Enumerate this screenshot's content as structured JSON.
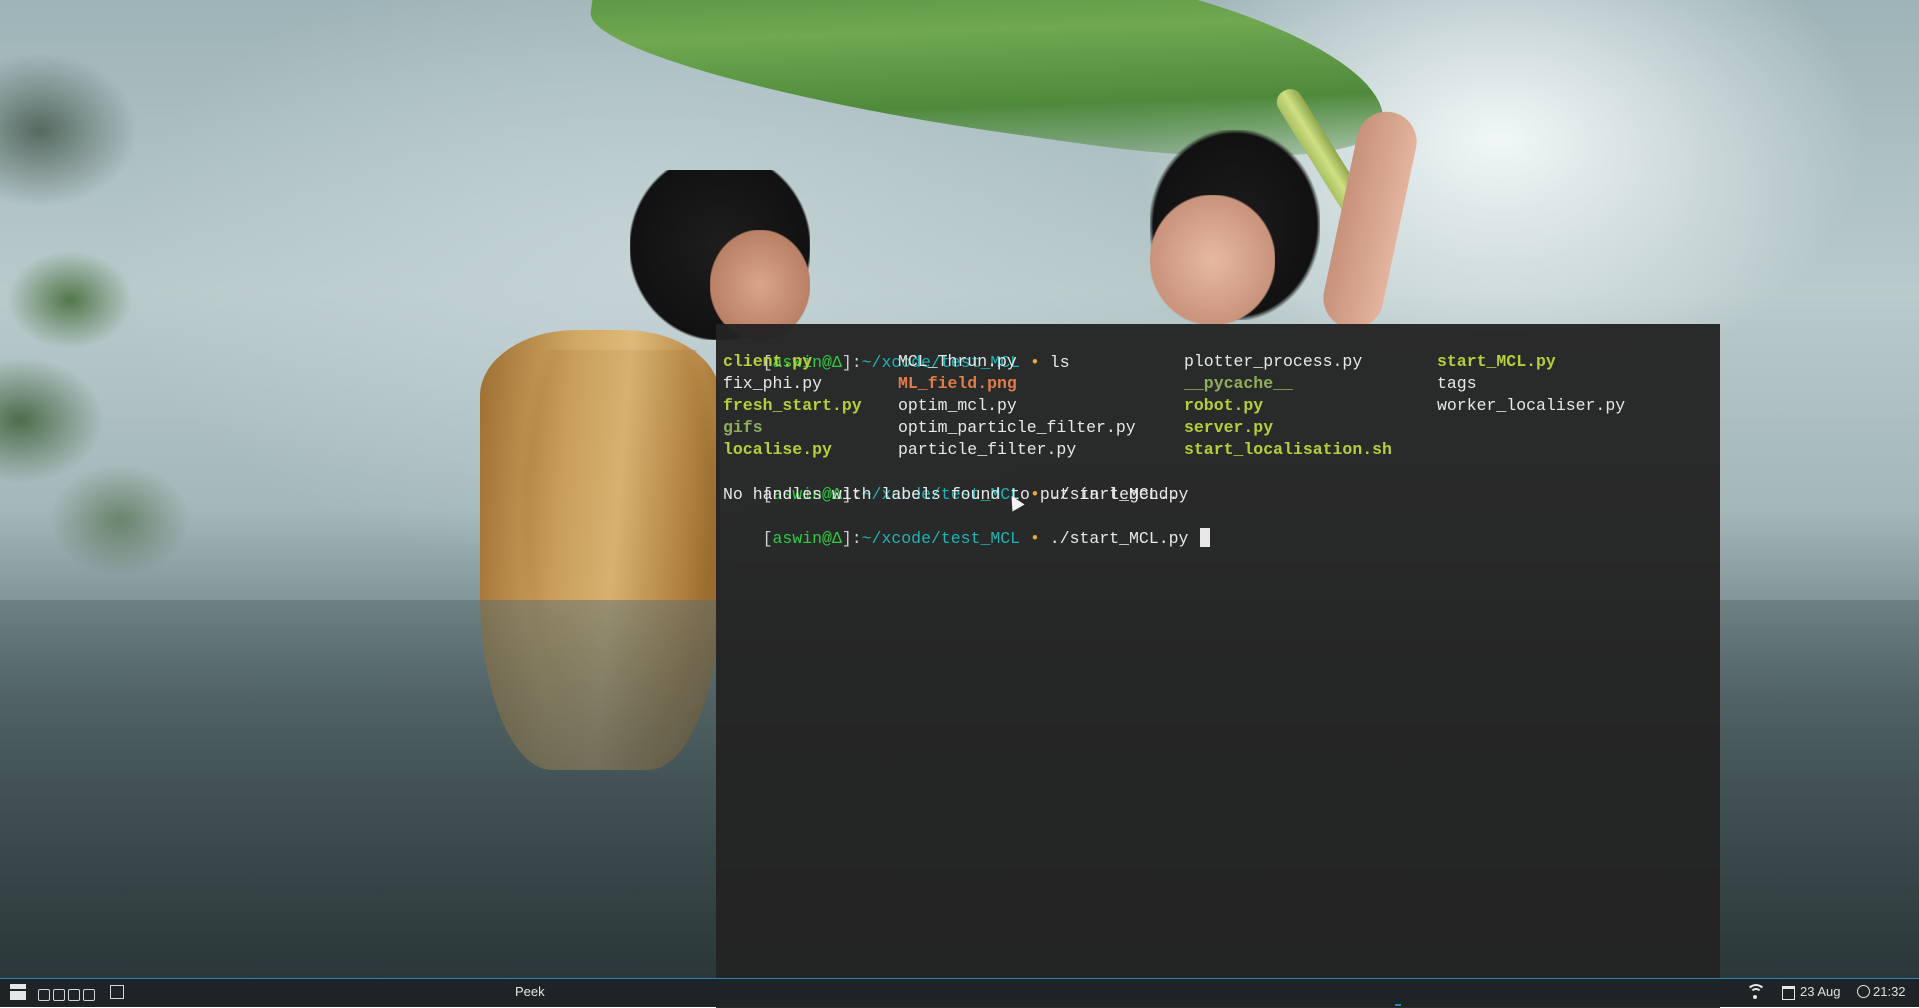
{
  "terminal": {
    "prompt": {
      "bracket_open": "[",
      "user": "aswin@",
      "host_symbol": "Δ",
      "bracket_close": "]:",
      "path": "~/xcode/test_MCL",
      "arrow": "•"
    },
    "lines": [
      {
        "command": " ls"
      },
      {
        "command": " ./start_MCL.py"
      },
      {
        "command": " ./start_MCL.py "
      }
    ],
    "ls_output": [
      [
        "client.py",
        "MCL_Thrun.py",
        "plotter_process.py",
        "start_MCL.py"
      ],
      [
        "fix_phi.py",
        "ML_field.png",
        "__pycache__",
        "tags"
      ],
      [
        "fresh_start.py",
        "optim_mcl.py",
        "robot.py",
        "worker_localiser.py"
      ],
      [
        "gifs",
        "optim_particle_filter.py",
        "server.py",
        ""
      ],
      [
        "localise.py",
        "particle_filter.py",
        "start_localisation.sh",
        ""
      ]
    ],
    "message": "No handles with labels found to put in legend."
  },
  "taskbar": {
    "task_label": "Peek",
    "date": "23 Aug",
    "time": "21:32",
    "icons": [
      "start-menu-icon",
      "quick-launch-icons",
      "show-desktop-icon",
      "wifi-icon",
      "calendar-icon",
      "clock-icon"
    ]
  },
  "colors": {
    "user": "#2ecc40",
    "path": "#1fb3b3",
    "prompt_arrow": "#e5a83a",
    "executable": "#b5cf3b",
    "directory": "#8fae5a",
    "image_file": "#e07d4a",
    "terminal_bg": "#232323",
    "taskbar_bg": "#1e2326",
    "taskbar_accent": "#2a86b8"
  }
}
